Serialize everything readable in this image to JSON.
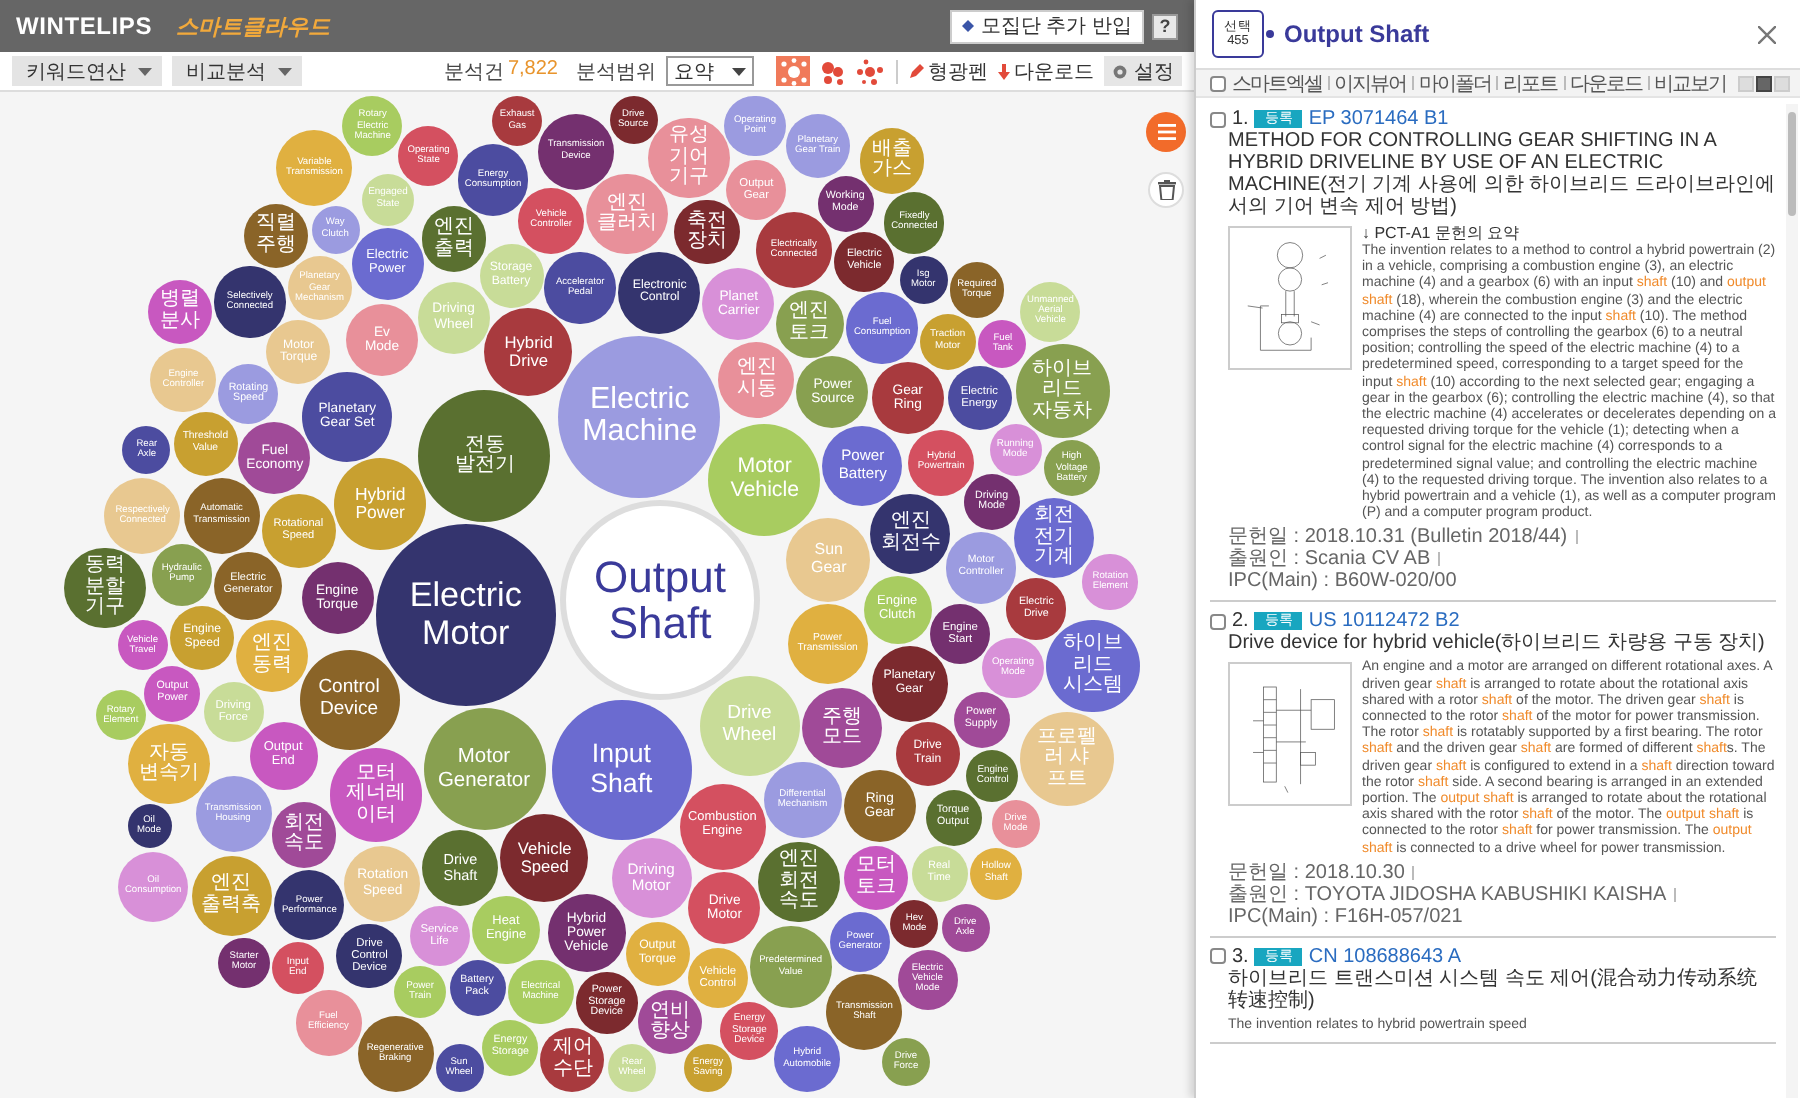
{
  "header": {
    "logo": "WINTELIPS",
    "service": "스마트클라우드",
    "add_button": "모집단 추가 반입",
    "help": "?"
  },
  "toolbar": {
    "dropdowns": [
      {
        "label": "키워드연산"
      },
      {
        "label": "비교분석"
      }
    ],
    "count_label": "분석건",
    "count": "7,822",
    "scope_label": "분석범위",
    "scope_value": "요약",
    "views": [
      {
        "selected": true
      },
      {
        "selected": false
      },
      {
        "selected": false
      }
    ],
    "highlighter": "형광펜",
    "download": "다운로드",
    "settings": "설정"
  },
  "bubble_chart": {
    "center": "Output Shaft",
    "bubbles": [
      {
        "label": "Rotary Electric Machine",
        "color": "#a8cc60"
      },
      {
        "label": "Exhaust Gas",
        "color": "#a83a3e"
      },
      {
        "label": "Drive Source",
        "color": "#7c2a2e"
      },
      {
        "label": "Operating Point",
        "color": "#9b9be0"
      },
      {
        "label": "Engaged State",
        "color": "#c8dc98"
      },
      {
        "label": "Operating State",
        "color": "#d45060"
      },
      {
        "label": "Energy Consumption",
        "color": "#4c4ca0"
      },
      {
        "label": "Transmission Device",
        "color": "#74306f"
      },
      {
        "label": "Vehicle Controller",
        "color": "#d45060"
      },
      {
        "label": "엔진 클러치",
        "color": "#e8909a"
      },
      {
        "label": "유성 기어 기구",
        "color": "#e8909a"
      },
      {
        "label": "Output Gear",
        "color": "#e8909a"
      },
      {
        "label": "Planetary Gear Train",
        "color": "#9b9be0"
      },
      {
        "label": "Working Mode",
        "color": "#74306f"
      },
      {
        "label": "배출 가스",
        "color": "#c8a030"
      },
      {
        "label": "직렬 주행",
        "color": "#8a6428"
      },
      {
        "label": "Variable Transmission",
        "color": "#e0b040"
      },
      {
        "label": "Way Clutch",
        "color": "#9b9be0"
      },
      {
        "label": "엔진 출력",
        "color": "#5a7030"
      },
      {
        "label": "Storage Battery",
        "color": "#c8dc98"
      },
      {
        "label": "Accelerator Pedal",
        "color": "#4c4ca0"
      },
      {
        "label": "축전 장치",
        "color": "#7c2a2e"
      },
      {
        "label": "Electrically Connected",
        "color": "#a83a3e"
      },
      {
        "label": "Electric Vehicle",
        "color": "#7c2a2e"
      },
      {
        "label": "Fixedly Connected",
        "color": "#5a7030"
      },
      {
        "label": "Isg Motor",
        "color": "#34346e"
      },
      {
        "label": "병렬 분사",
        "color": "#c858c0"
      },
      {
        "label": "Selectively Connected",
        "color": "#34346e"
      },
      {
        "label": "Planetary Gear Mechanism",
        "color": "#e8c890"
      },
      {
        "label": "Electric Power",
        "color": "#6b6bd0"
      },
      {
        "label": "Driving Wheel",
        "color": "#c8dc98"
      },
      {
        "label": "Electronic Control",
        "color": "#34346e"
      },
      {
        "label": "Planet Carrier",
        "color": "#d890d8"
      },
      {
        "label": "엔진 토크",
        "color": "#88a050"
      },
      {
        "label": "Fuel Consumption",
        "color": "#6b6bd0"
      },
      {
        "label": "Traction Motor",
        "color": "#c8a030"
      },
      {
        "label": "Required Torque",
        "color": "#8a6428"
      },
      {
        "label": "Fuel Tank",
        "color": "#c858c0"
      },
      {
        "label": "Engine Controller",
        "color": "#e8c890"
      },
      {
        "label": "Rotating Speed",
        "color": "#9b9be0"
      },
      {
        "label": "Motor Torque",
        "color": "#e8c890"
      },
      {
        "label": "Ev Mode",
        "color": "#e8909a"
      },
      {
        "label": "Hybrid Drive",
        "color": "#a83a3e"
      },
      {
        "label": "엔진 시동",
        "color": "#e8909a"
      },
      {
        "label": "Power Source",
        "color": "#88a050"
      },
      {
        "label": "Gear Ring",
        "color": "#a83a3e"
      },
      {
        "label": "Electric Energy",
        "color": "#4c4ca0"
      },
      {
        "label": "Unmanned Aerial Vehicle",
        "color": "#c8dc98"
      },
      {
        "label": "하이브리드 자동차",
        "color": "#88a050"
      },
      {
        "label": "Rear Axle",
        "color": "#4c4ca0"
      },
      {
        "label": "Threshold Value",
        "color": "#c8a030"
      },
      {
        "label": "Fuel Economy",
        "color": "#a04a98"
      },
      {
        "label": "Planetary Gear Set",
        "color": "#4c4ca0"
      },
      {
        "label": "전동 발전기",
        "color": "#5a7030"
      },
      {
        "label": "Power Battery",
        "color": "#6b6bd0"
      },
      {
        "label": "Hybrid Powertrain",
        "color": "#d45060"
      },
      {
        "label": "Running Mode",
        "color": "#d890d8"
      },
      {
        "label": "Automatic Transmission",
        "color": "#8a6428"
      },
      {
        "label": "Rotational Speed",
        "color": "#c8a030"
      },
      {
        "label": "Hybrid Power",
        "color": "#c8a030"
      },
      {
        "label": "Electric Machine",
        "color": "#9b9be0"
      },
      {
        "label": "Motor Vehicle",
        "color": "#a8cc60"
      },
      {
        "label": "엔진 회전수",
        "color": "#34346e"
      },
      {
        "label": "Driving Mode",
        "color": "#74306f"
      },
      {
        "label": "High Voltage Battery",
        "color": "#88a050"
      },
      {
        "label": "동력 분할 기구",
        "color": "#5a7030"
      },
      {
        "label": "Respectively Connected",
        "color": "#e8c890"
      },
      {
        "label": "Hydraulic Pump",
        "color": "#88a050"
      },
      {
        "label": "Electric Generator",
        "color": "#8a6428"
      },
      {
        "label": "Sun Gear",
        "color": "#e8c890"
      },
      {
        "label": "Motor Controller",
        "color": "#9b9be0"
      },
      {
        "label": "회전 전기 기계",
        "color": "#6b6bd0"
      },
      {
        "label": "Rotation Element",
        "color": "#d890d8"
      },
      {
        "label": "Vehicle Travel",
        "color": "#c858c0"
      },
      {
        "label": "Engine Speed",
        "color": "#c8a030"
      },
      {
        "label": "Engine Torque",
        "color": "#74306f"
      },
      {
        "label": "Electric Motor",
        "color": "#34346e"
      },
      {
        "label": "Power Transmission",
        "color": "#e0b040"
      },
      {
        "label": "Engine Clutch",
        "color": "#a8cc60"
      },
      {
        "label": "Engine Start",
        "color": "#74306f"
      },
      {
        "label": "Electric Drive",
        "color": "#a83a3e"
      },
      {
        "label": "Output Power",
        "color": "#c858c0"
      },
      {
        "label": "Driving Force",
        "color": "#c8dc98"
      },
      {
        "label": "엔진 동력",
        "color": "#e0b040"
      },
      {
        "label": "Control Device",
        "color": "#8a6428"
      },
      {
        "label": "Planetary Gear",
        "color": "#7c2a2e"
      },
      {
        "label": "Power Supply",
        "color": "#a04a98"
      },
      {
        "label": "Operating Mode",
        "color": "#d890d8"
      },
      {
        "label": "하이브리드 시스템",
        "color": "#6b6bd0"
      },
      {
        "label": "Rotary Element",
        "color": "#a8cc60"
      },
      {
        "label": "자동 변속기",
        "color": "#e0b040"
      },
      {
        "label": "Output End",
        "color": "#c858c0"
      },
      {
        "label": "모터 제너레이터",
        "color": "#c858c0"
      },
      {
        "label": "Motor Generator",
        "color": "#88a050"
      },
      {
        "label": "Input Shaft",
        "color": "#6b6bd0"
      },
      {
        "label": "Drive Wheel",
        "color": "#c8dc98"
      },
      {
        "label": "주행 모드",
        "color": "#a04a98"
      },
      {
        "label": "Drive Train",
        "color": "#a83a3e"
      },
      {
        "label": "Engine Control",
        "color": "#5a7030"
      },
      {
        "label": "프로펠러 샤프트",
        "color": "#e8c890"
      },
      {
        "label": "Oil Mode",
        "color": "#34346e"
      },
      {
        "label": "Transmission Housing",
        "color": "#9b9be0"
      },
      {
        "label": "회전 속도",
        "color": "#a04a98"
      },
      {
        "label": "Vehicle Speed",
        "color": "#7c2a2e"
      },
      {
        "label": "Combustion Engine",
        "color": "#d45060"
      },
      {
        "label": "Differential Mechanism",
        "color": "#9b9be0"
      },
      {
        "label": "Ring Gear",
        "color": "#8a6428"
      },
      {
        "label": "Torque Output",
        "color": "#5a7030"
      },
      {
        "label": "Drive Mode",
        "color": "#e8909a"
      },
      {
        "label": "Oil Consumption",
        "color": "#d890d8"
      },
      {
        "label": "엔진 출력축",
        "color": "#c8a030"
      },
      {
        "label": "Power Performance",
        "color": "#34346e"
      },
      {
        "label": "Rotation Speed",
        "color": "#e8c890"
      },
      {
        "label": "Drive Shaft",
        "color": "#5a7030"
      },
      {
        "label": "Driving Motor",
        "color": "#d890d8"
      },
      {
        "label": "Drive Motor",
        "color": "#d45060"
      },
      {
        "label": "엔진 회전 속도",
        "color": "#5a7030"
      },
      {
        "label": "모터 토크",
        "color": "#c858c0"
      },
      {
        "label": "Real Time",
        "color": "#c8dc98"
      },
      {
        "label": "Hollow Shaft",
        "color": "#e0b040"
      },
      {
        "label": "Starter Motor",
        "color": "#74306f"
      },
      {
        "label": "Input End",
        "color": "#d45060"
      },
      {
        "label": "Drive Control Device",
        "color": "#34346e"
      },
      {
        "label": "Service Life",
        "color": "#d890d8"
      },
      {
        "label": "Heat Engine",
        "color": "#a8cc60"
      },
      {
        "label": "Hybrid Power Vehicle",
        "color": "#74306f"
      },
      {
        "label": "Output Torque",
        "color": "#e0b040"
      },
      {
        "label": "Predetermined Value",
        "color": "#88a050"
      },
      {
        "label": "Power Generator",
        "color": "#6b6bd0"
      },
      {
        "label": "Hev Mode",
        "color": "#7c2a2e"
      },
      {
        "label": "Drive Axle",
        "color": "#a04a98"
      },
      {
        "label": "Fuel Efficiency",
        "color": "#e8909a"
      },
      {
        "label": "Power Train",
        "color": "#a8cc60"
      },
      {
        "label": "Regenerative Braking",
        "color": "#8a6428"
      },
      {
        "label": "Battery Pack",
        "color": "#4c4ca0"
      },
      {
        "label": "Energy Storage",
        "color": "#a8cc60"
      },
      {
        "label": "Electrical Machine",
        "color": "#a8cc60"
      },
      {
        "label": "제어 수단",
        "color": "#a83a3e"
      },
      {
        "label": "Power Storage Device",
        "color": "#7c2a2e"
      },
      {
        "label": "연비 향상",
        "color": "#a04a98"
      },
      {
        "label": "Vehicle Control",
        "color": "#e0b040"
      },
      {
        "label": "Energy Storage Device",
        "color": "#d45060"
      },
      {
        "label": "Transmission Shaft",
        "color": "#8a6428"
      },
      {
        "label": "Drive Force",
        "color": "#88a050"
      },
      {
        "label": "Electric Vehicle Mode",
        "color": "#a04a98"
      },
      {
        "label": "Sun Wheel",
        "color": "#4c4ca0"
      },
      {
        "label": "Rear Wheel",
        "color": "#c8dc98"
      },
      {
        "label": "Energy Saving",
        "color": "#c8a030"
      },
      {
        "label": "Hybrid Automobile",
        "color": "#6b6bd0"
      }
    ]
  },
  "panel": {
    "selected_label": "선택",
    "selected_count": "455",
    "title": "Output Shaft",
    "select_all": {
      "checked": false
    },
    "links": [
      "스마트엑셀",
      "이지뷰어",
      "마이폴더",
      "리포트",
      "다운로드",
      "비교보기"
    ],
    "view_modes": [
      {
        "selected": false
      },
      {
        "selected": true
      },
      {
        "selected": false
      }
    ],
    "results": [
      {
        "checked": false,
        "index": "1.",
        "status": "등록",
        "number": "EP 3071464 B1",
        "title": "METHOD FOR CONTROLLING GEAR SHIFTING IN A HYBRID DRIVELINE BY USE OF AN ELECTRIC MACHINE(전기 기계 사용에 의한 하이브리드 드라이브라인에서의 기어 변속 제어 방법)",
        "drawing": true,
        "note": "↓ PCT-A1 문헌의 요약",
        "abstract": "The invention relates to a method to control a hybrid powertrain (2) in a vehicle, comprising a combustion engine (3), an electric machine (4) and a gearbox (6) with an input **shaft** (10) and **output shaft** (18), wherein the combustion engine (3) and the electric machine (4) are connected to the input **shaft** (10). The method comprises the steps of controlling the gearbox (6) to a neutral position; controlling the speed of the electric machine (4) to a predetermined speed, corresponding to a target speed for the input **shaft** (10) according to the next selected gear; engaging a gear in the gearbox (6); controlling the electric machine (4), so that the electric machine (4) accelerates or decelerates depending on a requested driving torque for the vehicle (1); detecting when a control signal for the electric machine (4) corresponds to a predetermined signal value; and controlling the electric machine (4) to the requested driving torque. The invention also relates to a hybrid powertrain and a vehicle (1), as well as a computer program (P) and a computer program product.",
        "date": "문헌일 : 2018.10.31 (Bulletin 2018/44)",
        "applicant": "출원인 : Scania CV AB",
        "ipc": "IPC(Main) : B60W-020/00"
      },
      {
        "checked": false,
        "index": "2.",
        "status": "등록",
        "number": "US 10112472 B2",
        "title": "Drive device for hybrid vehicle(하이브리드 차량용 구동 장치)",
        "drawing": true,
        "abstract": "An engine and a motor are arranged on different rotational axes. A driven gear **shaft** is arranged to rotate about the rotational axis shared with a rotor **shaft** of the motor. The driven gear **shaft** is connected to the rotor **shaft** of the motor for power transmission. The rotor **shaft** is rotatably supported by a first bearing. The rotor **shaft** and the driven gear **shaft** are formed of different **shaft**s. The driven gear **shaft** is configured to extend in a **shaft** direction toward the rotor **shaft** side. A second bearing is arranged in an extended portion. The **output shaft** is arranged to rotate about the rotational axis shared with the rotor **shaft** of the motor. The **output shaft** is connected to the rotor **shaft** for power transmission. The **output shaft** is connected to a drive wheel for power transmission.",
        "date": "문헌일 : 2018.10.30",
        "applicant": "출원인 : TOYOTA JIDOSHA KABUSHIKI KAISHA",
        "ipc": "IPC(Main) : F16H-057/021"
      },
      {
        "checked": false,
        "index": "3.",
        "status": "등록",
        "number": "CN 108688643 A",
        "title": "하이브리드 트랜스미션 시스템 속도 제어(混合动力传动系统转速控制)",
        "abstract": "The invention relates to hybrid powertrain speed"
      }
    ]
  }
}
